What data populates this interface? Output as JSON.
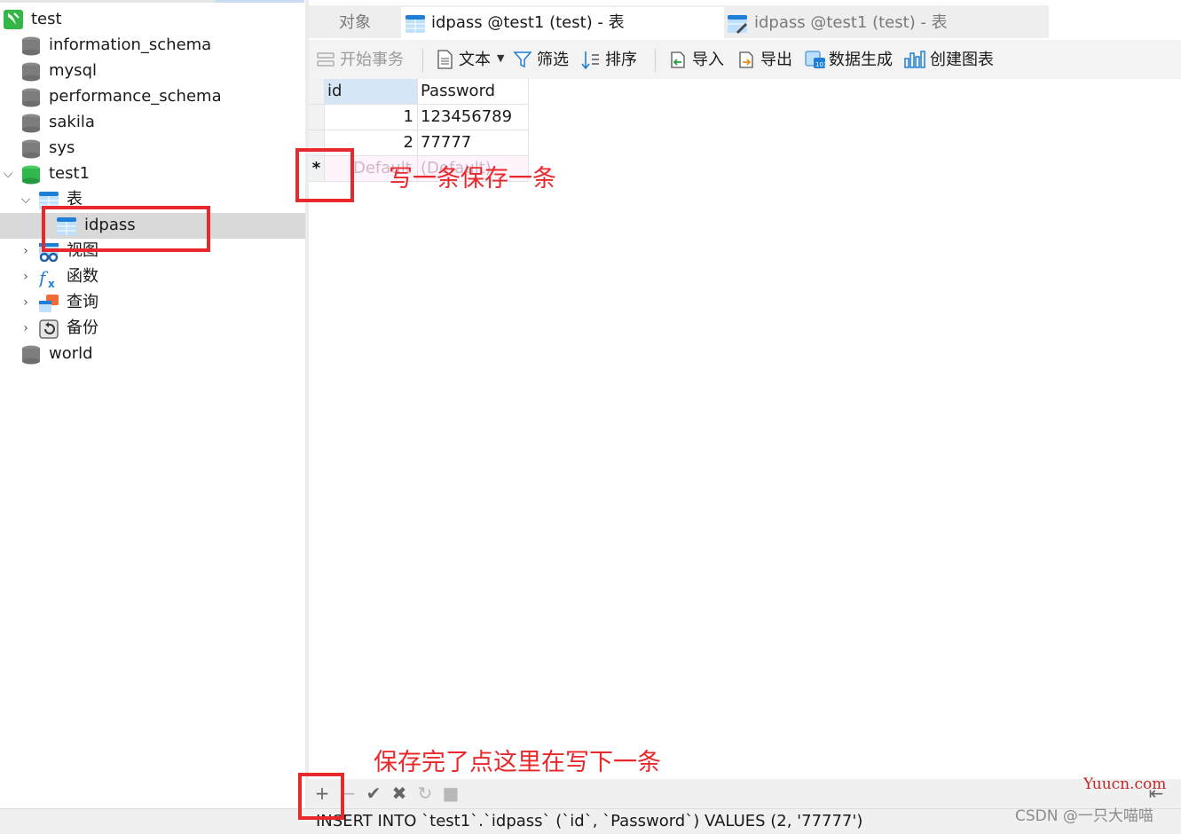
{
  "tree": {
    "connection": "test",
    "databases": [
      {
        "label": "information_schema"
      },
      {
        "label": "mysql"
      },
      {
        "label": "performance_schema"
      },
      {
        "label": "sakila"
      },
      {
        "label": "sys"
      },
      {
        "label": "test1"
      }
    ],
    "test1_children": {
      "tables_label": "表",
      "table_item": "idpass",
      "views_label": "视图",
      "functions_label": "函数",
      "queries_label": "查询",
      "backups_label": "备份"
    },
    "last_db": "world"
  },
  "tabs": [
    {
      "label": "对象"
    },
    {
      "label": "idpass @test1 (test) - 表"
    },
    {
      "label": "idpass @test1 (test) - 表"
    }
  ],
  "toolbar": {
    "begin_tx": "开始事务",
    "text": "文本",
    "filter": "筛选",
    "sort": "排序",
    "import": "导入",
    "export": "导出",
    "data_gen": "数据生成",
    "create_chart": "创建图表"
  },
  "grid": {
    "columns": [
      "id",
      "Password"
    ],
    "rows": [
      {
        "id": "1",
        "password": "123456789"
      },
      {
        "id": "2",
        "password": "77777"
      }
    ],
    "new_row_marker": "*",
    "new_row_values": [
      "Default",
      "(Default)"
    ]
  },
  "status": {
    "sql": "INSERT INTO `test1`.`idpass` (`id`, `Password`) VALUES (2, '77777')"
  },
  "annotations": {
    "write_one": "写一条保存一条",
    "save_then_next": "保存完了点这里在写下一条"
  },
  "watermarks": {
    "yuucn": "Yuucn.com",
    "csdn": "CSDN @一只大喵喵"
  },
  "colors": {
    "annotation_red": "#e8282b",
    "selected_row": "#d9d9d9",
    "db_icon_green": "#2fb84e",
    "db_icon_gray": "#7d7d7d"
  }
}
